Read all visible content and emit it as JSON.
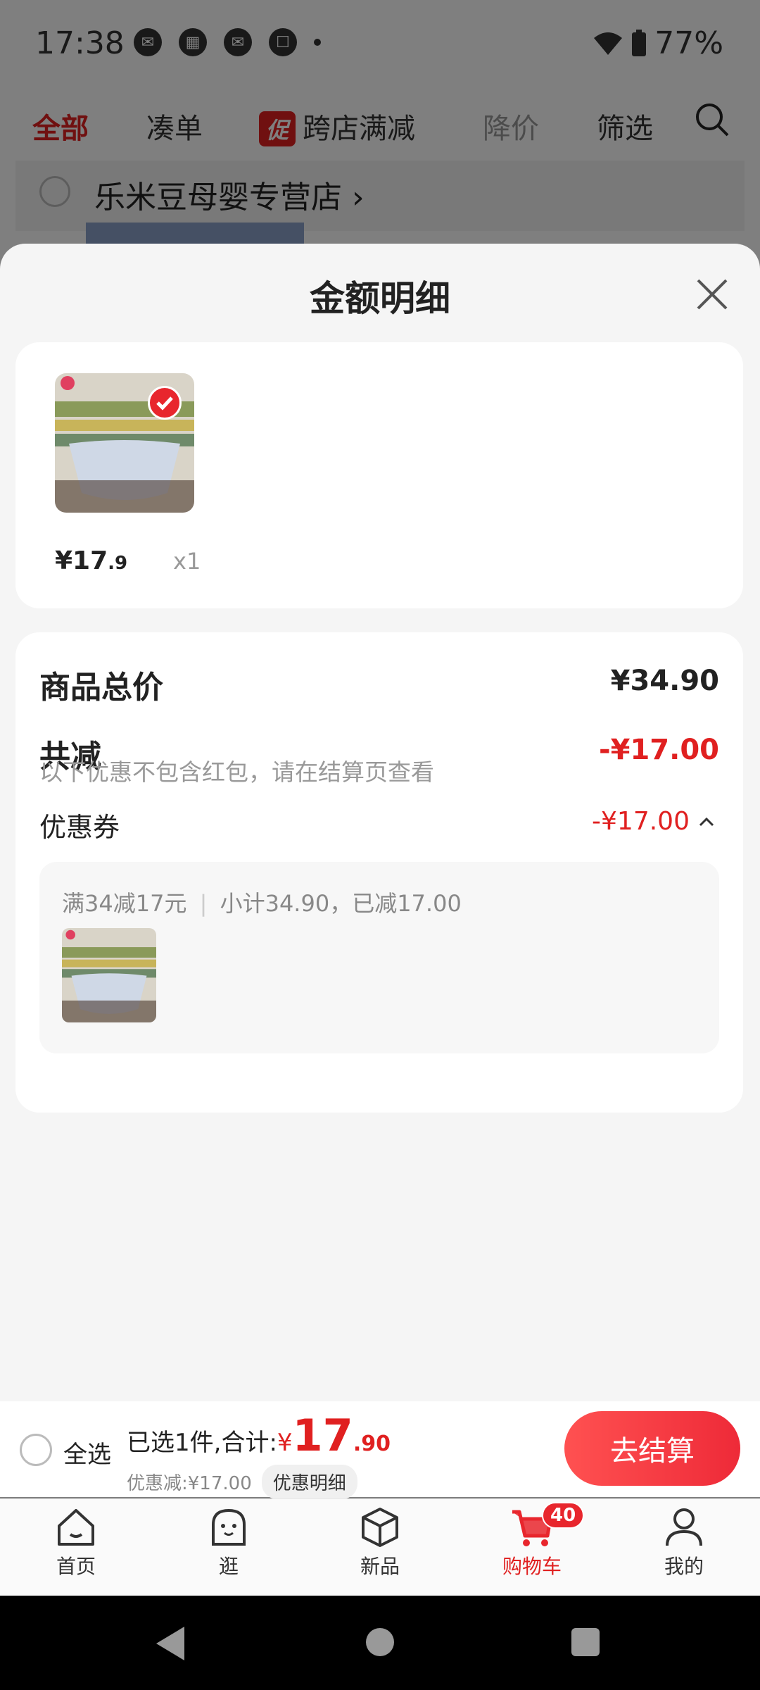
{
  "status_bar": {
    "time": "17:38",
    "battery": "77%"
  },
  "top_tabs": [
    {
      "label": "全部"
    },
    {
      "label": "凑单"
    },
    {
      "badge": "促",
      "label": "跨店满减"
    },
    {
      "label": "降价"
    },
    {
      "label": "筛选"
    }
  ],
  "store": {
    "name": "乐米豆母婴专营店",
    "chevron": "›"
  },
  "sheet": {
    "title": "金额明细",
    "item": {
      "price_int": "¥17",
      "price_dec": ".9",
      "qty": "x1"
    },
    "summary": {
      "total_label": "商品总价",
      "total_value": "¥34.90",
      "discount_label": "共减",
      "discount_value": "-¥17.00",
      "note": "以下优惠不包含红包，请在结算页查看",
      "coupon_label": "优惠券",
      "coupon_value": "-¥17.00",
      "coupon_rule": "满34减17元",
      "coupon_detail": "小计34.90，已减17.00"
    }
  },
  "checkout": {
    "select_all": "全选",
    "selected_prefix": "已选1件,合计:",
    "currency": "¥",
    "total_int": "17",
    "total_dec": ".90",
    "discount": "优惠减:¥17.00",
    "detail_button": "优惠明细",
    "checkout_button": "去结算"
  },
  "tab_bar": {
    "items": [
      {
        "label": "首页",
        "icon": "home-icon"
      },
      {
        "label": "逛",
        "icon": "face-icon"
      },
      {
        "label": "新品",
        "icon": "box-icon"
      },
      {
        "label": "购物车",
        "icon": "cart-icon",
        "badge": "40"
      },
      {
        "label": "我的",
        "icon": "user-icon"
      }
    ]
  },
  "colors": {
    "accent": "#e02020",
    "button": "#ee2a38"
  }
}
